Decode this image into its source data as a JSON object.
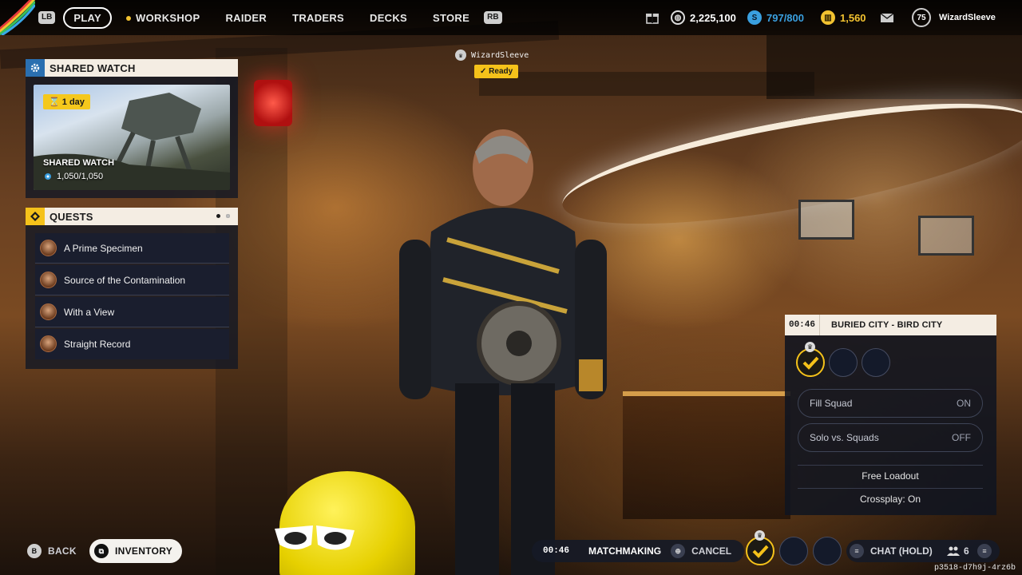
{
  "topbar": {
    "lb_key": "LB",
    "rb_key": "RB",
    "tabs": [
      {
        "label": "PLAY",
        "active": true
      },
      {
        "label": "WORKSHOP"
      },
      {
        "label": "RAIDER"
      },
      {
        "label": "TRADERS"
      },
      {
        "label": "DECKS"
      },
      {
        "label": "STORE"
      }
    ],
    "currency_coins": "2,225,100",
    "currency_tokens": "797/800",
    "currency_gold": "1,560",
    "player_level": "75",
    "player_name": "WizardSleeve"
  },
  "shared_watch": {
    "header": "SHARED WATCH",
    "time_badge": "1 day",
    "card_title": "SHARED WATCH",
    "card_value": "1,050/1,050"
  },
  "quests": {
    "header": "QUESTS",
    "items": [
      {
        "label": "A Prime Specimen"
      },
      {
        "label": "Source of the Contamination"
      },
      {
        "label": "With a View"
      },
      {
        "label": "Straight Record"
      }
    ]
  },
  "lobby": {
    "player_name": "WizardSleeve",
    "status": "Ready"
  },
  "matchmaking": {
    "timer": "00:46",
    "map": "BURIED CITY - BIRD CITY",
    "fill_squad_label": "Fill Squad",
    "fill_squad_value": "ON",
    "solo_vs_squads_label": "Solo vs. Squads",
    "solo_vs_squads_value": "OFF",
    "loadout": "Free Loadout",
    "crossplay": "Crossplay: On"
  },
  "bottombar": {
    "back_key": "B",
    "back_label": "BACK",
    "inventory_label": "INVENTORY",
    "timer": "00:46",
    "status": "MATCHMAKING",
    "cancel_label": "CANCEL",
    "chat_label": "CHAT (HOLD)",
    "party_count": "6",
    "build_id": "p3518-d7h9j-4rz6b"
  },
  "colors": {
    "accent_yellow": "#f5c21a",
    "panel_header": "#f4ede3",
    "panel_dark": "#1a1e2e",
    "token_blue": "#3aa0e0"
  }
}
